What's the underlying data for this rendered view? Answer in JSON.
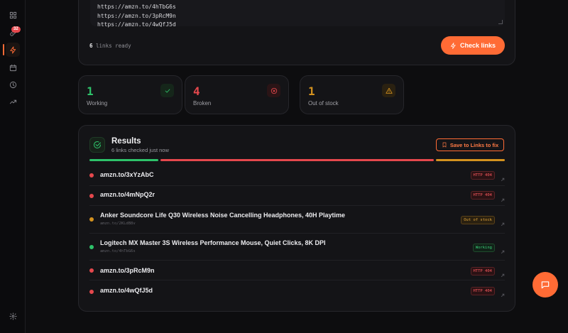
{
  "sidebar": {
    "badge_count": "32",
    "icons": [
      "dashboard-icon",
      "link-icon",
      "bolt-icon",
      "calendar-icon",
      "clock-icon",
      "trend-icon",
      "settings-icon"
    ]
  },
  "input": {
    "lines": [
      "https://amzn.to/4hTbG6s",
      "https://amzn.to/3pRcM9n",
      "https://amzn.to/4wQfJ5d"
    ]
  },
  "status": {
    "count": "6",
    "suffix": " links ready",
    "check_label": "Check links"
  },
  "stats": [
    {
      "value": "1",
      "label": "Working",
      "color": "#2ec26a"
    },
    {
      "value": "4",
      "label": "Broken",
      "color": "#e5484d"
    },
    {
      "value": "1",
      "label": "Out of stock",
      "color": "#d4921f"
    }
  ],
  "results": {
    "title": "Results",
    "subtitle": "6 links checked just now",
    "save_label": "Save to Links to fix",
    "summary": {
      "working": 1,
      "broken": 4,
      "out_of_stock": 1
    },
    "rows": [
      {
        "title": "amzn.to/3xYzAbC",
        "sub": "",
        "badge": "HTTP 404",
        "status": "broken"
      },
      {
        "title": "amzn.to/4mNpQ2r",
        "sub": "",
        "badge": "HTTP 404",
        "status": "broken"
      },
      {
        "title": "Anker Soundcore Life Q30 Wireless Noise Cancelling Headphones, 40H Playtime",
        "sub": "amzn.to/2KLdB8v",
        "badge": "Out of stock",
        "status": "out_of_stock"
      },
      {
        "title": "Logitech MX Master 3S Wireless Performance Mouse, Quiet Clicks, 8K DPI",
        "sub": "amzn.to/4hTbG6s",
        "badge": "Working",
        "status": "working"
      },
      {
        "title": "amzn.to/3pRcM9n",
        "sub": "",
        "badge": "HTTP 404",
        "status": "broken"
      },
      {
        "title": "amzn.to/4wQfJ5d",
        "sub": "",
        "badge": "HTTP 404",
        "status": "broken"
      }
    ]
  },
  "colors": {
    "accent": "#ff6b35",
    "working": "#2ec26a",
    "broken": "#e5484d",
    "out_of_stock": "#d4921f"
  }
}
